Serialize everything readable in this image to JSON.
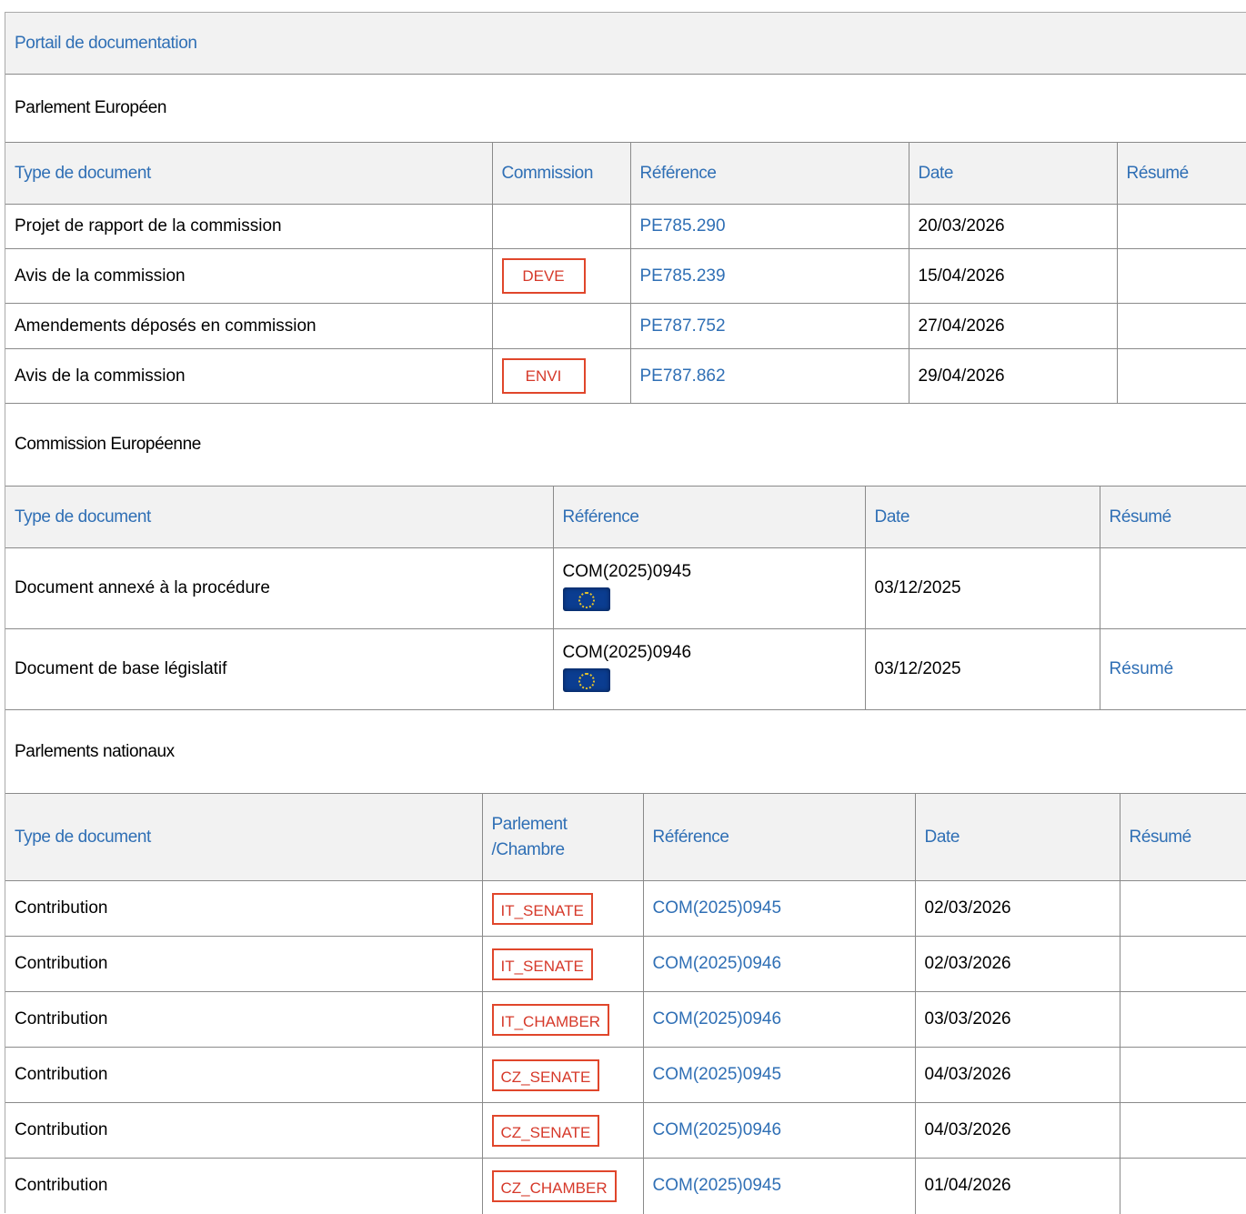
{
  "portal": {
    "title": "Portail de documentation"
  },
  "ep": {
    "title": "Parlement Européen",
    "headers": [
      "Type de document",
      "Commission",
      "Référence",
      "Date",
      "Résumé"
    ],
    "rows": [
      {
        "type": "Projet de rapport de la commission",
        "commission": "",
        "reference": "PE785.290",
        "date": "20/03/2026",
        "summary": ""
      },
      {
        "type": "Avis de la commission",
        "commission": "DEVE",
        "reference": "PE785.239",
        "date": "15/04/2026",
        "summary": ""
      },
      {
        "type": "Amendements déposés en commission",
        "commission": "",
        "reference": "PE787.752",
        "date": "27/04/2026",
        "summary": ""
      },
      {
        "type": "Avis de la commission",
        "commission": "ENVI",
        "reference": "PE787.862",
        "date": "29/04/2026",
        "summary": ""
      }
    ]
  },
  "ec": {
    "title": "Commission Européenne",
    "headers": [
      "Type de document",
      "Référence",
      "Date",
      "Résumé"
    ],
    "rows": [
      {
        "type": "Document annexé à la procédure",
        "reference": "COM(2025)0945",
        "flag_icon": "eu-flag-icon",
        "date": "03/12/2025",
        "summary": ""
      },
      {
        "type": "Document de base législatif",
        "reference": "COM(2025)0946",
        "flag_icon": "eu-flag-icon",
        "date": "03/12/2025",
        "summary": "Résumé"
      }
    ]
  },
  "np": {
    "title": "Parlements nationaux",
    "headers": [
      "Type de document",
      "Parlement /Chambre",
      "Référence",
      "Date",
      "Résumé"
    ],
    "rows": [
      {
        "type": "Contribution",
        "chamber": "IT_SENATE",
        "reference": "COM(2025)0945",
        "date": "02/03/2026",
        "summary": ""
      },
      {
        "type": "Contribution",
        "chamber": "IT_SENATE",
        "reference": "COM(2025)0946",
        "date": "02/03/2026",
        "summary": ""
      },
      {
        "type": "Contribution",
        "chamber": "IT_CHAMBER",
        "reference": "COM(2025)0946",
        "date": "03/03/2026",
        "summary": ""
      },
      {
        "type": "Contribution",
        "chamber": "CZ_SENATE",
        "reference": "COM(2025)0945",
        "date": "04/03/2026",
        "summary": ""
      },
      {
        "type": "Contribution",
        "chamber": "CZ_SENATE",
        "reference": "COM(2025)0946",
        "date": "04/03/2026",
        "summary": ""
      },
      {
        "type": "Contribution",
        "chamber": "CZ_CHAMBER",
        "reference": "COM(2025)0945",
        "date": "01/04/2026",
        "summary": ""
      }
    ]
  },
  "colors": {
    "link": "#2f6fb5",
    "badge_border": "#e0462b",
    "header_bg": "#f2f2f2",
    "eu_flag": "#0b3d91"
  }
}
